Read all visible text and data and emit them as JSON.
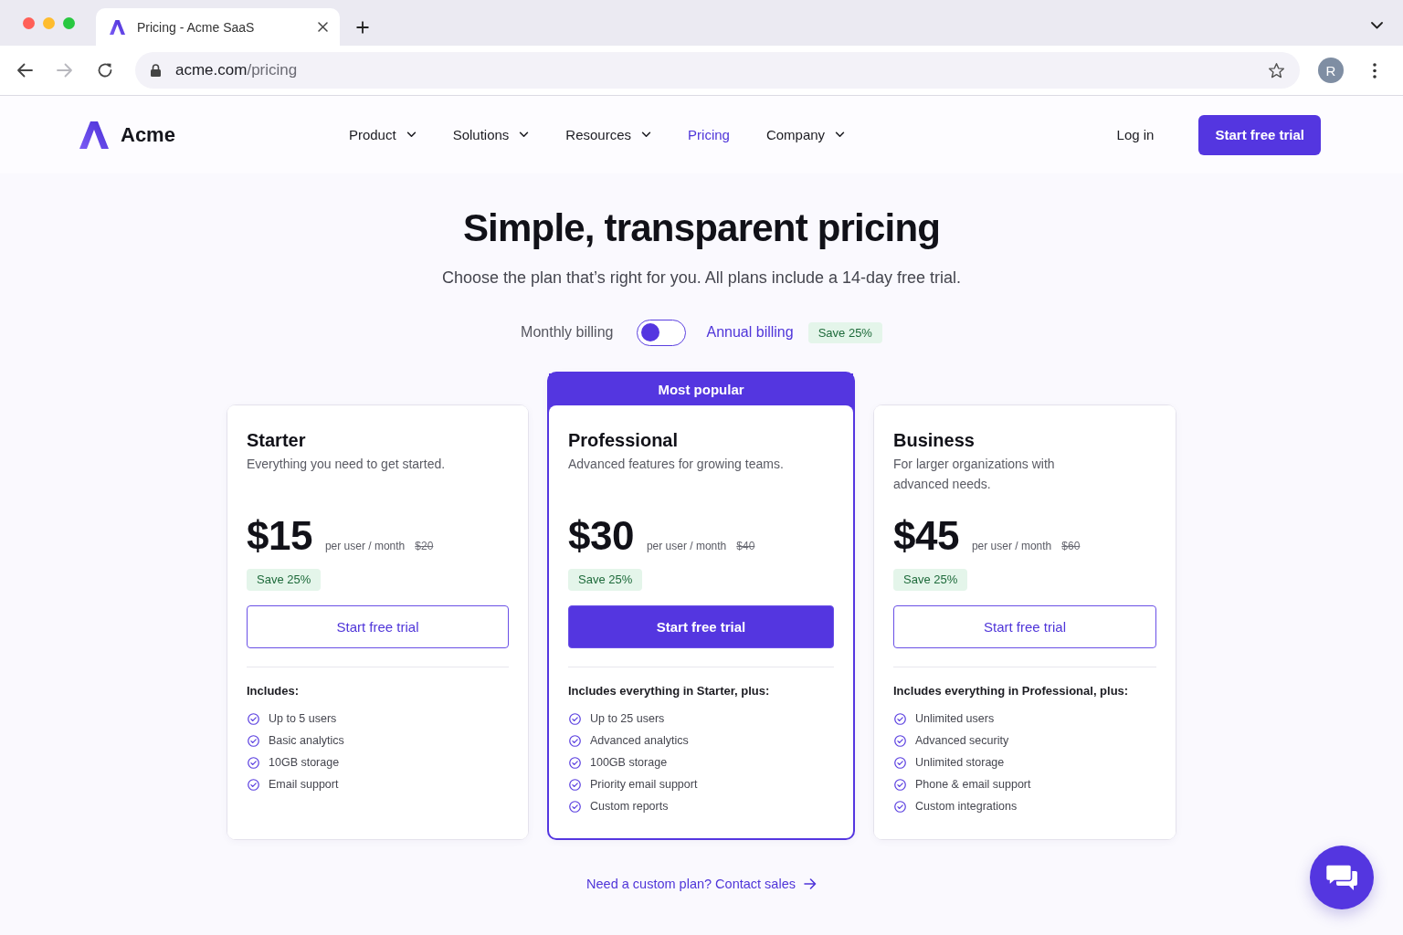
{
  "browser": {
    "tab_title": "Pricing - Acme SaaS",
    "url_host": "acme.com",
    "url_path": "/pricing",
    "forward_disabled": true,
    "profile_initial": "R"
  },
  "nav": {
    "brand": "Acme",
    "links": [
      {
        "label": "Product",
        "dropdown": true,
        "selected": false
      },
      {
        "label": "Solutions",
        "dropdown": true,
        "selected": false
      },
      {
        "label": "Resources",
        "dropdown": true,
        "selected": false
      },
      {
        "label": "Pricing",
        "dropdown": false,
        "selected": true
      },
      {
        "label": "Company",
        "dropdown": true,
        "selected": false
      }
    ],
    "login": "Log in",
    "cta": "Start free trial"
  },
  "hero": {
    "title": "Simple, transparent pricing",
    "subtitle": "Choose the plan that’s right for you. All plans include a 14-day free trial."
  },
  "billing": {
    "options": [
      {
        "label": "Monthly billing",
        "selected": false
      },
      {
        "label": "Annual billing",
        "selected": true
      }
    ],
    "toggle_on": false,
    "badge": "Save 25%"
  },
  "plans": [
    {
      "name": "Starter",
      "description": "Everything you need to get started.",
      "price": "$15",
      "period": "per user / month",
      "old_price": "$20",
      "badge": "Save 25%",
      "button": "Start free trial",
      "featured": false,
      "features_heading": "Includes:",
      "features": [
        "Up to 5 users",
        "Basic analytics",
        "10GB storage",
        "Email support"
      ]
    },
    {
      "ribbon": "Most popular",
      "name": "Professional",
      "description": "Advanced features for growing teams.",
      "price": "$30",
      "period": "per user / month",
      "old_price": "$40",
      "badge": "Save 25%",
      "button": "Start free trial",
      "featured": true,
      "features_heading": "Includes everything in Starter, plus:",
      "features": [
        "Up to 25 users",
        "Advanced analytics",
        "100GB storage",
        "Priority email support",
        "Custom reports"
      ]
    },
    {
      "name": "Business",
      "description": "For larger organizations with advanced needs.",
      "price": "$45",
      "period": "per user / month",
      "old_price": "$60",
      "badge": "Save 25%",
      "button": "Start free trial",
      "featured": false,
      "features_heading": "Includes everything in Professional, plus:",
      "features": [
        "Unlimited users",
        "Advanced security",
        "Unlimited storage",
        "Phone & email support",
        "Custom integrations"
      ]
    }
  ],
  "footer": {
    "contact_link": "Need a custom plan? Contact sales"
  }
}
